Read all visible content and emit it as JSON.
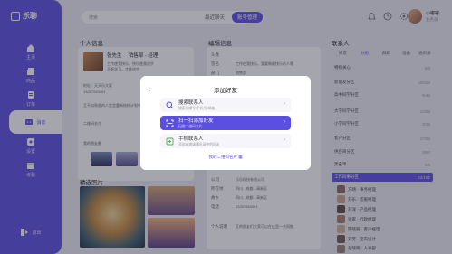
{
  "app": {
    "logo_text": "乐聊"
  },
  "sidebar": {
    "items": [
      {
        "label": "主页",
        "icon": "home-icon"
      },
      {
        "label": "商品",
        "icon": "shop-icon"
      },
      {
        "label": "订单",
        "icon": "order-icon"
      },
      {
        "label": "消息",
        "icon": "message-icon",
        "active": true
      },
      {
        "label": "设置",
        "icon": "settings-icon"
      },
      {
        "label": "考勤",
        "icon": "calendar-icon"
      }
    ],
    "logout_label": "退出"
  },
  "header": {
    "search_placeholder": "搜索",
    "tabs": [
      "最近聊天",
      "账号管理"
    ],
    "active_tab": "账号管理",
    "user_name": "小嘟嘟",
    "user_role": "业务员"
  },
  "profile": {
    "title": "个人信息",
    "name": "张先生",
    "dept": "销售部 - 经理",
    "bio1": "工作使我快乐，快乐使我进步",
    "bio2": "不断学习，才能进步",
    "address_label": "地址：天天乐大厦",
    "phone": "13257940001",
    "note": "互不向熟悉的人定会重新结构计划中一",
    "qr_label": "二维码名片",
    "album_label": "我的朋友圈",
    "featured_label": "精选照片"
  },
  "edit": {
    "title": "编辑信息",
    "fields": [
      {
        "label": "头像",
        "value": ""
      },
      {
        "label": "签名",
        "value": "工作使我快乐，我要做最快乐的人哦"
      },
      {
        "label": "部门",
        "value": "销售部"
      },
      {
        "label": "公司",
        "value": "乐乐科技有限公司"
      },
      {
        "label": "所在地",
        "value": "四川 - 成都 - 高新区"
      },
      {
        "label": "故乡",
        "value": "四川 - 成都 - 高新区"
      },
      {
        "label": "电话",
        "value": "13257940001"
      },
      {
        "label": "个人说明",
        "value": "互的朋友们大家可以在这里一共同勉"
      }
    ]
  },
  "contacts": {
    "title": "联系人",
    "tabs": [
      "好友",
      "分组",
      "群聊",
      "设备",
      "通讯录"
    ],
    "active_tab": "分组",
    "groups": [
      {
        "name": "特别关心",
        "count": "3/3"
      },
      {
        "name": "新朋友分区",
        "count": "18/112"
      },
      {
        "name": "高中同学分区",
        "count": "6/48"
      },
      {
        "name": "大学同学分区",
        "count": "12/52"
      },
      {
        "name": "小学同学分区",
        "count": "8/36"
      },
      {
        "name": "客户分区",
        "count": "17/84"
      },
      {
        "name": "供应商分区",
        "count": "9/60"
      },
      {
        "name": "黑名单",
        "count": "0/8"
      },
      {
        "name": "工作同事分区",
        "count": "22/182",
        "highlight": true
      }
    ],
    "people": [
      {
        "name": "方晴 · 事务经理"
      },
      {
        "name": "刘乐 · 客服经理"
      },
      {
        "name": "刘洋 · 产品经理"
      },
      {
        "name": "张家 · 行政经理"
      },
      {
        "name": "陈晓丽 · 客户经理"
      },
      {
        "name": "刘芳 · 室内设计"
      },
      {
        "name": "赵晓晓 · 人事部"
      }
    ]
  },
  "modal": {
    "title": "添加好友",
    "options": [
      {
        "title": "搜索联系人",
        "desc": "搜索乐聊号/手机号/邮箱",
        "icon": "search-icon"
      },
      {
        "title": "扫一扫添加好友",
        "desc": "扫描二维码名片",
        "icon": "scan-icon",
        "active": true
      },
      {
        "title": "手机联系人",
        "desc": "添加或邀请通讯录中的好友",
        "icon": "phone-contacts-icon"
      }
    ],
    "qr_link": "我的二维码名片"
  },
  "colors": {
    "accent": "#5b4fe0"
  }
}
